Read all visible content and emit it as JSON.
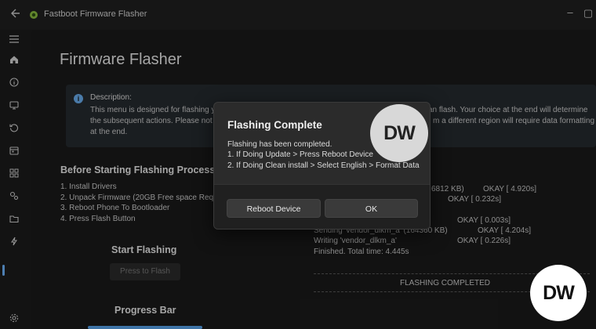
{
  "titlebar": {
    "back_icon": "arrow-left-icon",
    "app_icon": "android-icon",
    "title": "Fastboot Firmware Flasher"
  },
  "sidebar": {
    "items": [
      {
        "icon": "hamburger-menu-icon"
      },
      {
        "icon": "home-icon"
      },
      {
        "icon": "info-icon"
      },
      {
        "icon": "device-icon"
      },
      {
        "icon": "history-icon"
      },
      {
        "icon": "calendar-icon"
      },
      {
        "icon": "apps-grid-icon"
      },
      {
        "icon": "gears-icon"
      },
      {
        "icon": "folder-icon"
      },
      {
        "icon": "flash-icon",
        "active": true
      },
      {
        "icon": "settings-icon"
      }
    ]
  },
  "page": {
    "title": "Firmware Flasher"
  },
  "info_card": {
    "heading": "Description:",
    "line1_left": "This menu is designed for flashing y",
    "line1_right": "an flash. Your choice at the end will determine",
    "line2_left": "the subsequent actions. Please not",
    "line2_right": "m a different region will require data formatting",
    "line3": "at the end."
  },
  "before_section": {
    "title": "Before Starting Flashing Process",
    "steps": [
      "1. Install Drivers",
      "2. Unpack Firmware (20GB Free space Requi",
      "3. Reboot Phone To Bootloader",
      "4. Press Flash Button"
    ]
  },
  "start_section": {
    "title": "Start Flashing",
    "button": "Press to Flash"
  },
  "progress_section": {
    "title": "Progress Bar",
    "progress": 1.0
  },
  "log": {
    "line1_left": "6812 KB)",
    "line1_right": "OKAY [  4.920s]",
    "line2_right": "OKAY [  0.232s]",
    "line3_right": "OKAY [  0.003s]",
    "line4_left": "Sending 'vendor_dlkm_a' (164360 KB)",
    "line4_right": "OKAY [  4.204s]",
    "line5_left": "Writing 'vendor_dlkm_a'",
    "line5_right": "OKAY [  0.226s]",
    "line6": "Finished. Total time: 4.445s",
    "completed": "FLASHING COMPLETED"
  },
  "dialog": {
    "title": "Flashing Complete",
    "lines": [
      "Flashing has been completed.",
      "1. If Doing Update > Press Reboot Device",
      "2. If Doing Clean install > Select English > Format Data"
    ],
    "reboot_label": "Reboot Device",
    "ok_label": "OK"
  },
  "watermark": {
    "text": "DW"
  },
  "colors": {
    "accent": "#5aa7f0",
    "background": "#1b1b1b",
    "dialog": "#2b2b2b"
  }
}
